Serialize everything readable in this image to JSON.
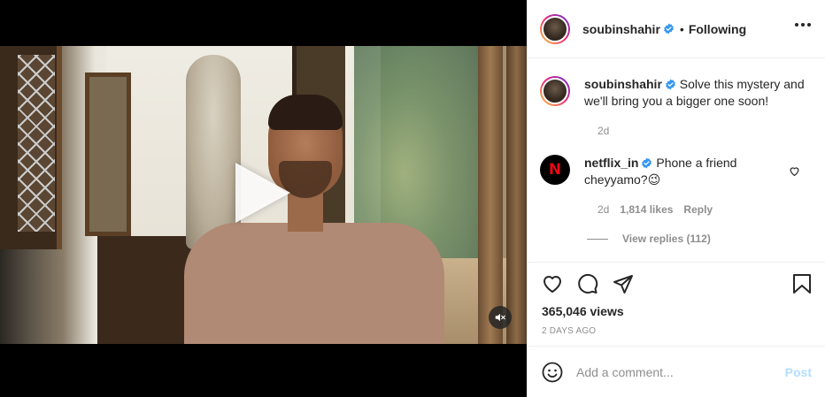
{
  "post": {
    "author": "soubinshahir",
    "follow_separator": "•",
    "follow_label": "Following",
    "caption_text": "Solve this mystery and we'll bring you a bigger one soon!",
    "caption_time": "2d",
    "views": "365,046 views",
    "date": "2 DAYS AGO"
  },
  "comment": {
    "author": "netflix_in",
    "avatar_letter": "N",
    "text": "Phone a friend cheyyamo?😉",
    "time": "2d",
    "likes": "1,814 likes",
    "reply_label": "Reply",
    "view_replies": "View replies (112)"
  },
  "comment_box": {
    "placeholder": "Add a comment...",
    "post_label": "Post"
  },
  "colors": {
    "verified": "#3897f0",
    "post_disabled": "#b2dffc",
    "muted_text": "#8e8e8e",
    "netflix_red": "#e50914"
  },
  "icons": {
    "play": "play-icon",
    "mute": "muted-speaker-icon",
    "like": "heart-icon",
    "comment": "speech-bubble-icon",
    "share": "paper-plane-icon",
    "save": "bookmark-icon",
    "more": "ellipsis-icon",
    "emoji": "smiley-icon",
    "verified": "verified-badge-icon"
  }
}
